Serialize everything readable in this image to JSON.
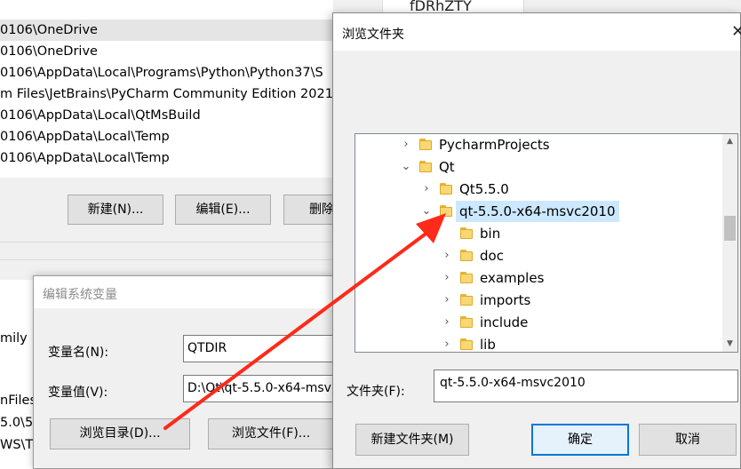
{
  "background_window": {
    "top_tab_text": "fDRhZTY",
    "list_rows": [
      "0106\\OneDrive",
      "0106\\OneDrive",
      "0106\\AppData\\Local\\Programs\\Python\\Python37\\S",
      "m Files\\JetBrains\\PyCharm Community Edition 2021.",
      "0106\\AppData\\Local\\QtMsBuild",
      "0106\\AppData\\Local\\Temp",
      "0106\\AppData\\Local\\Temp"
    ],
    "buttons": {
      "new": "新建(N)...",
      "edit": "编辑(E)...",
      "delete": "删除"
    },
    "lower_fragments": [
      "mily",
      "nFiles",
      "5.0\\5",
      "WS\\T"
    ]
  },
  "edit_dialog": {
    "title": "编辑系统变量",
    "name_label": "变量名(N):",
    "name_value": "QTDIR",
    "value_label": "变量值(V):",
    "value_value": "D:\\Qt\\qt-5.5.0-x64-msv",
    "browse_dir_button": "浏览目录(D)...",
    "browse_file_button": "浏览文件(F)..."
  },
  "browse_dialog": {
    "title": "浏览文件夹",
    "close_glyph": "✕",
    "tree": [
      {
        "label": "PycharmProjects",
        "expanded": false
      },
      {
        "label": "Qt",
        "expanded": true
      },
      {
        "label": "Qt5.5.0",
        "expanded": false
      },
      {
        "label": "qt-5.5.0-x64-msvc2010",
        "expanded": true,
        "selected": true
      },
      {
        "label": "bin",
        "expanded": null
      },
      {
        "label": "doc",
        "expanded": false
      },
      {
        "label": "examples",
        "expanded": false
      },
      {
        "label": "imports",
        "expanded": false
      },
      {
        "label": "include",
        "expanded": false
      },
      {
        "label": "lib",
        "expanded": false
      }
    ],
    "folder_label": "文件夹(F):",
    "folder_value": "qt-5.5.0-x64-msvc2010",
    "buttons": {
      "new_folder": "新建文件夹(M)",
      "ok": "确定",
      "cancel": "取消"
    }
  },
  "annotation": {
    "arrow_color": "#ff2a1a"
  },
  "colors": {
    "selection": "#cce8ff",
    "primary_border": "#0078d7",
    "folder": "#f8d774"
  }
}
